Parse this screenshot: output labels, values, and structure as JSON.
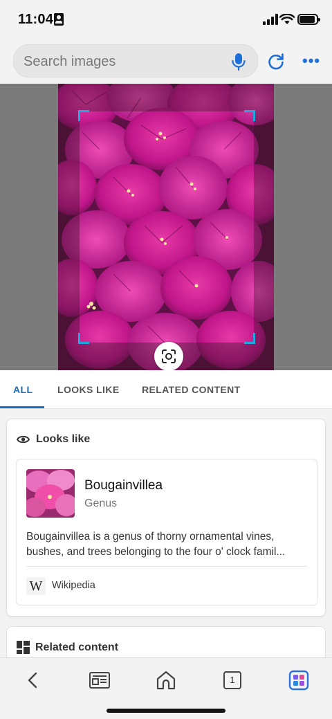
{
  "status_bar": {
    "time": "11:04"
  },
  "search": {
    "placeholder": "Search images"
  },
  "tabs": [
    {
      "label": "ALL",
      "active": true
    },
    {
      "label": "LOOKS LIKE",
      "active": false
    },
    {
      "label": "RELATED CONTENT",
      "active": false
    }
  ],
  "looks_like": {
    "section_title": "Looks like",
    "result": {
      "title": "Bougainvillea",
      "subtitle": "Genus",
      "description": "Bougainvillea is a genus of thorny ornamental vines, bushes, and trees belonging to the four o' clock famil...",
      "source_logo": "W",
      "source": "Wikipedia"
    }
  },
  "related_content": {
    "section_title": "Related content"
  },
  "bottom_nav": {
    "tab_count": "1",
    "icons": [
      "back-icon",
      "reader-icon",
      "home-icon",
      "tabs-icon",
      "apps-icon"
    ]
  },
  "colors": {
    "accent": "#1d6fb8",
    "crop_corners": "#20a8e0",
    "flower": "#c0168a"
  }
}
